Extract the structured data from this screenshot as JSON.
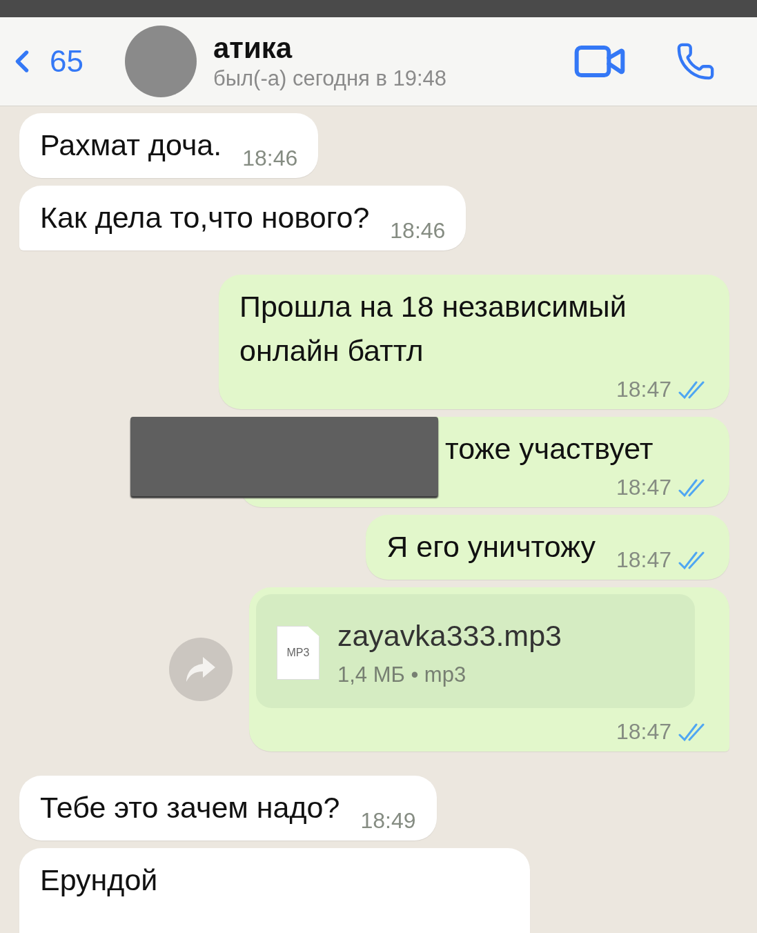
{
  "header": {
    "back_count": "65",
    "name": "атика",
    "status": "был(-а) сегодня в 19:48"
  },
  "messages": [
    {
      "kind": "in",
      "text": "Рахмат доча.",
      "time": "18:46"
    },
    {
      "kind": "in",
      "text": "Как дела то,что нового?",
      "time": "18:46",
      "tail": true
    },
    {
      "kind": "out",
      "text": "Прошла на 18 независимый онлайн баттл",
      "time": "18:47",
      "read": true
    },
    {
      "kind": "out",
      "text": "тоже участвует",
      "time": "18:47",
      "read": true,
      "redacted": true
    },
    {
      "kind": "out",
      "text": "Я его уничтожу",
      "time": "18:47",
      "read": true
    },
    {
      "kind": "file",
      "file_type": "MP3",
      "file_name": "zayavka333.mp3",
      "file_info": "1,4 МБ • mp3",
      "time": "18:47",
      "read": true,
      "tail": true
    },
    {
      "kind": "in",
      "text": "Тебе это зачем надо?",
      "time": "18:49"
    },
    {
      "kind": "in",
      "text": "Ерундой",
      "cut": true
    }
  ]
}
